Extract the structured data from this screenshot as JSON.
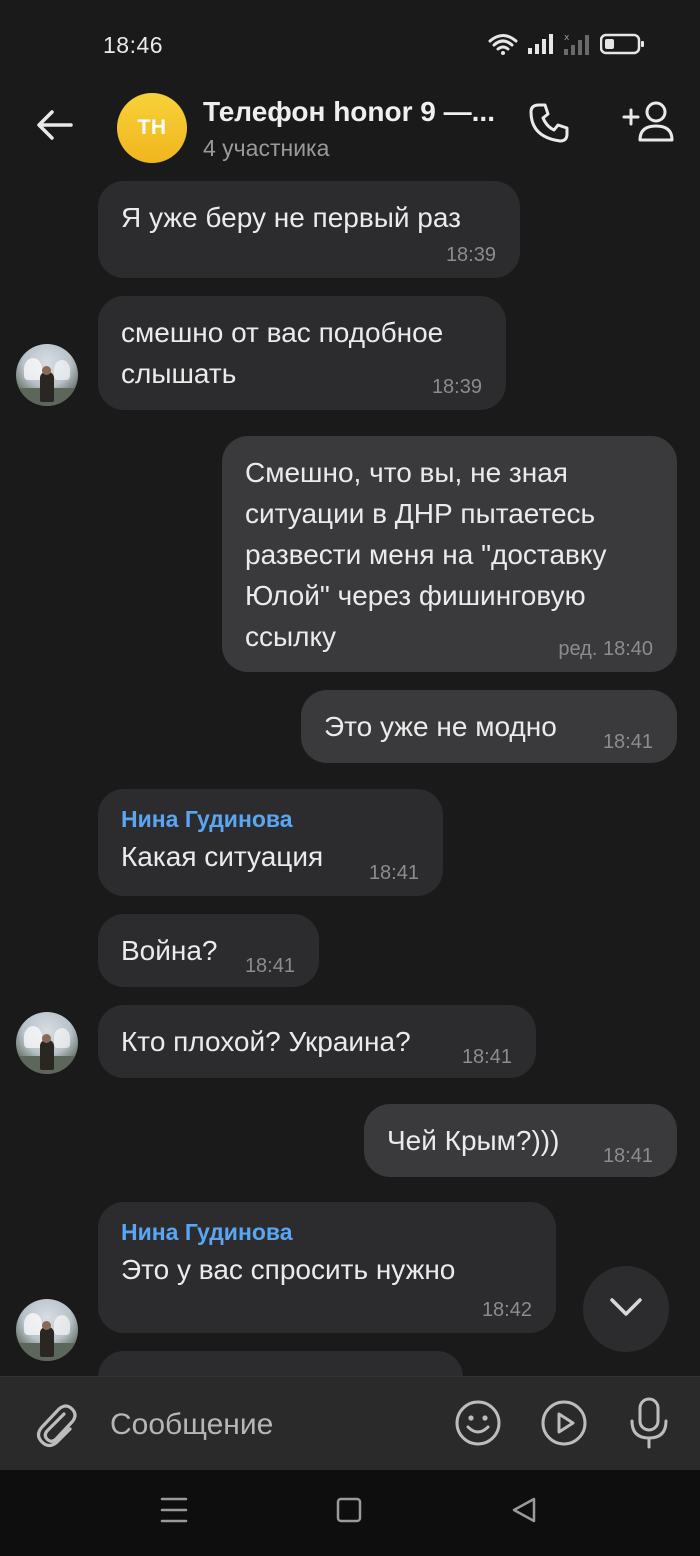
{
  "status_bar": {
    "time": "18:46"
  },
  "header": {
    "avatar_initials": "ТН",
    "title": "Телефон honor 9 —...",
    "subtitle": "4 участника"
  },
  "messages": [
    {
      "direction": "in",
      "text": "Я уже беру не первый раз",
      "time": "18:39"
    },
    {
      "direction": "in",
      "text": "смешно от вас подобное слышать",
      "time": "18:39"
    },
    {
      "direction": "out",
      "text": "Смешно, что вы, не зная ситуации в ДНР пытаетесь развести меня на \"доставку Юлой\" через фишинговую ссылку",
      "time": "ред. 18:40"
    },
    {
      "direction": "out",
      "text": "Это уже не модно",
      "time": "18:41"
    },
    {
      "direction": "in",
      "sender": "Нина Гудинова",
      "text": "Какая ситуация",
      "time": "18:41"
    },
    {
      "direction": "in",
      "text": "Война?",
      "time": "18:41"
    },
    {
      "direction": "in",
      "text": "Кто плохой? Украина?",
      "time": "18:41"
    },
    {
      "direction": "out",
      "text": "Чей Крым?)))",
      "time": "18:41"
    },
    {
      "direction": "in",
      "sender": "Нина Гудинова",
      "text": "Это у вас спросить нужно",
      "time": "18:42"
    }
  ],
  "composer": {
    "placeholder": "Сообщение"
  },
  "colors": {
    "background": "#1a1a1a",
    "bubble_in": "#2c2c2e",
    "bubble_out": "#3a3a3c",
    "sender_name": "#5aa6f2",
    "avatar": "#f4c42a"
  },
  "icons": [
    "wifi-icon",
    "signal-icon",
    "battery-icon",
    "back-arrow-icon",
    "phone-icon",
    "add-user-icon",
    "chevron-down-icon",
    "paperclip-icon",
    "emoji-icon",
    "video-message-icon",
    "microphone-icon",
    "nav-menu-icon",
    "nav-home-icon",
    "nav-back-icon"
  ]
}
